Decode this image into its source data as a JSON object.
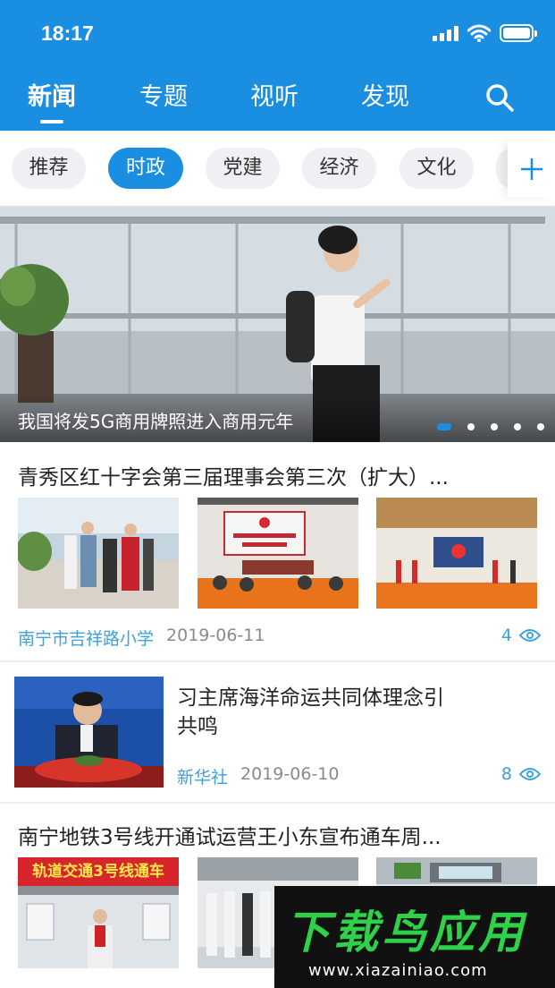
{
  "status_bar": {
    "time": "18:17"
  },
  "nav": {
    "tabs": [
      {
        "label": "新闻",
        "active": true
      },
      {
        "label": "专题",
        "active": false
      },
      {
        "label": "视听",
        "active": false
      },
      {
        "label": "发现",
        "active": false
      }
    ],
    "search_icon": "search-icon"
  },
  "chips": [
    {
      "label": "推荐",
      "active": false
    },
    {
      "label": "时政",
      "active": true
    },
    {
      "label": "党建",
      "active": false
    },
    {
      "label": "经济",
      "active": false
    },
    {
      "label": "文化",
      "active": false
    }
  ],
  "add_channel_icon": "plus-icon",
  "banner": {
    "caption": "我国将发5G商用牌照进入商用元年",
    "slide_count": 6,
    "active_slide": 1
  },
  "articles": [
    {
      "title": "青秀区红十字会第三届理事会第三次（扩大）...",
      "source": "南宁市吉祥路小学",
      "date": "2019-06-11",
      "views": "4",
      "thumbs": [
        "photo",
        "photo",
        "photo"
      ]
    },
    {
      "title": "习主席海洋命运共同体理念引共鸣",
      "title_line1": "习主席海洋命运共同体理念引",
      "title_line2": "共鸣",
      "source": "新华社",
      "date": "2019-06-10",
      "views": "8"
    },
    {
      "title": "南宁地铁3号线开通试运营王小东宣布通车周...",
      "thumb1_sign": "轨道交通3号线通车",
      "thumbs": [
        "photo",
        "photo",
        "photo"
      ]
    }
  ],
  "watermark": {
    "title": "下载鸟应用",
    "url": "www.xiazainiao.com"
  },
  "colors": {
    "brand": "#1a8ee0",
    "source_link": "#3da0dc",
    "chip_bg": "#eef0f3"
  }
}
